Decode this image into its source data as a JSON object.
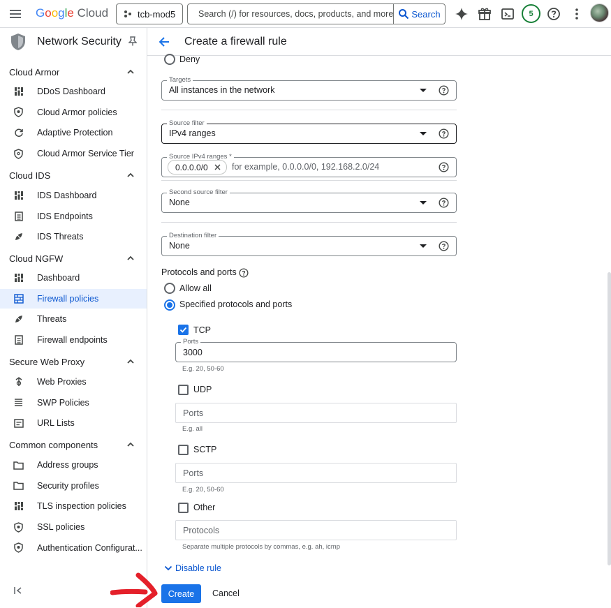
{
  "topbar": {
    "logo": {
      "g": "G",
      "o1": "o",
      "o2": "o",
      "g2": "g",
      "l": "l",
      "e": "e",
      "cloud": "Cloud"
    },
    "project": "tcb-mod5",
    "search_placeholder": "Search (/) for resources, docs, products, and more",
    "search_button": "Search",
    "notifications_count": "5"
  },
  "sidebar": {
    "title": "Network Security",
    "sections": [
      {
        "label": "Cloud Armor",
        "items": [
          {
            "label": "DDoS Dashboard",
            "icon": "dashboard-icon"
          },
          {
            "label": "Cloud Armor policies",
            "icon": "shield-icon"
          },
          {
            "label": "Adaptive Protection",
            "icon": "refresh-icon"
          },
          {
            "label": "Cloud Armor Service Tier",
            "icon": "settings-icon"
          }
        ]
      },
      {
        "label": "Cloud IDS",
        "items": [
          {
            "label": "IDS Dashboard",
            "icon": "dashboard-icon"
          },
          {
            "label": "IDS Endpoints",
            "icon": "list-icon"
          },
          {
            "label": "IDS Threats",
            "icon": "bug-icon"
          }
        ]
      },
      {
        "label": "Cloud NGFW",
        "items": [
          {
            "label": "Dashboard",
            "icon": "dashboard-icon"
          },
          {
            "label": "Firewall policies",
            "icon": "firewall-icon",
            "active": true
          },
          {
            "label": "Threats",
            "icon": "bug-icon"
          },
          {
            "label": "Firewall endpoints",
            "icon": "list-icon"
          }
        ]
      },
      {
        "label": "Secure Web Proxy",
        "items": [
          {
            "label": "Web Proxies",
            "icon": "proxy-icon"
          },
          {
            "label": "SWP Policies",
            "icon": "policy-list-icon"
          },
          {
            "label": "URL Lists",
            "icon": "url-list-icon"
          }
        ]
      },
      {
        "label": "Common components",
        "items": [
          {
            "label": "Address groups",
            "icon": "folder-icon"
          },
          {
            "label": "Security profiles",
            "icon": "folder-icon"
          },
          {
            "label": "TLS inspection policies",
            "icon": "dashboard-icon"
          },
          {
            "label": "SSL policies",
            "icon": "shield-icon"
          },
          {
            "label": "Authentication Configurat...",
            "icon": "shield-icon"
          }
        ]
      }
    ],
    "collapse_label": "<|"
  },
  "main": {
    "title": "Create a firewall rule",
    "deny_label": "Deny",
    "targets": {
      "label": "Targets",
      "value": "All instances in the network"
    },
    "source_filter": {
      "label": "Source filter",
      "value": "IPv4 ranges"
    },
    "source_ranges": {
      "label": "Source IPv4 ranges *",
      "chip": "0.0.0.0/0",
      "placeholder": "for example, 0.0.0.0/0, 192.168.2.0/24"
    },
    "second_source_filter": {
      "label": "Second source filter",
      "value": "None"
    },
    "destination_filter": {
      "label": "Destination filter",
      "value": "None"
    },
    "protocols": {
      "heading": "Protocols and ports",
      "allow_all": "Allow all",
      "specified": "Specified protocols and ports",
      "tcp": {
        "label": "TCP",
        "checked": true,
        "ports_label": "Ports",
        "ports_value": "3000",
        "hint": "E.g. 20, 50-60"
      },
      "udp": {
        "label": "UDP",
        "checked": false,
        "placeholder": "Ports",
        "hint": "E.g. all"
      },
      "sctp": {
        "label": "SCTP",
        "checked": false,
        "placeholder": "Ports",
        "hint": "E.g. 20, 50-60"
      },
      "other": {
        "label": "Other",
        "checked": false,
        "placeholder": "Protocols",
        "hint": "Separate multiple protocols by commas, e.g. ah, icmp"
      }
    },
    "disable_rule": "Disable rule",
    "create_button": "Create",
    "cancel_button": "Cancel"
  },
  "colors": {
    "accent": "#1a73e8",
    "link": "#0b57d0",
    "annotation_arrow": "#e4202a",
    "active_bg": "#e8f0fe"
  }
}
